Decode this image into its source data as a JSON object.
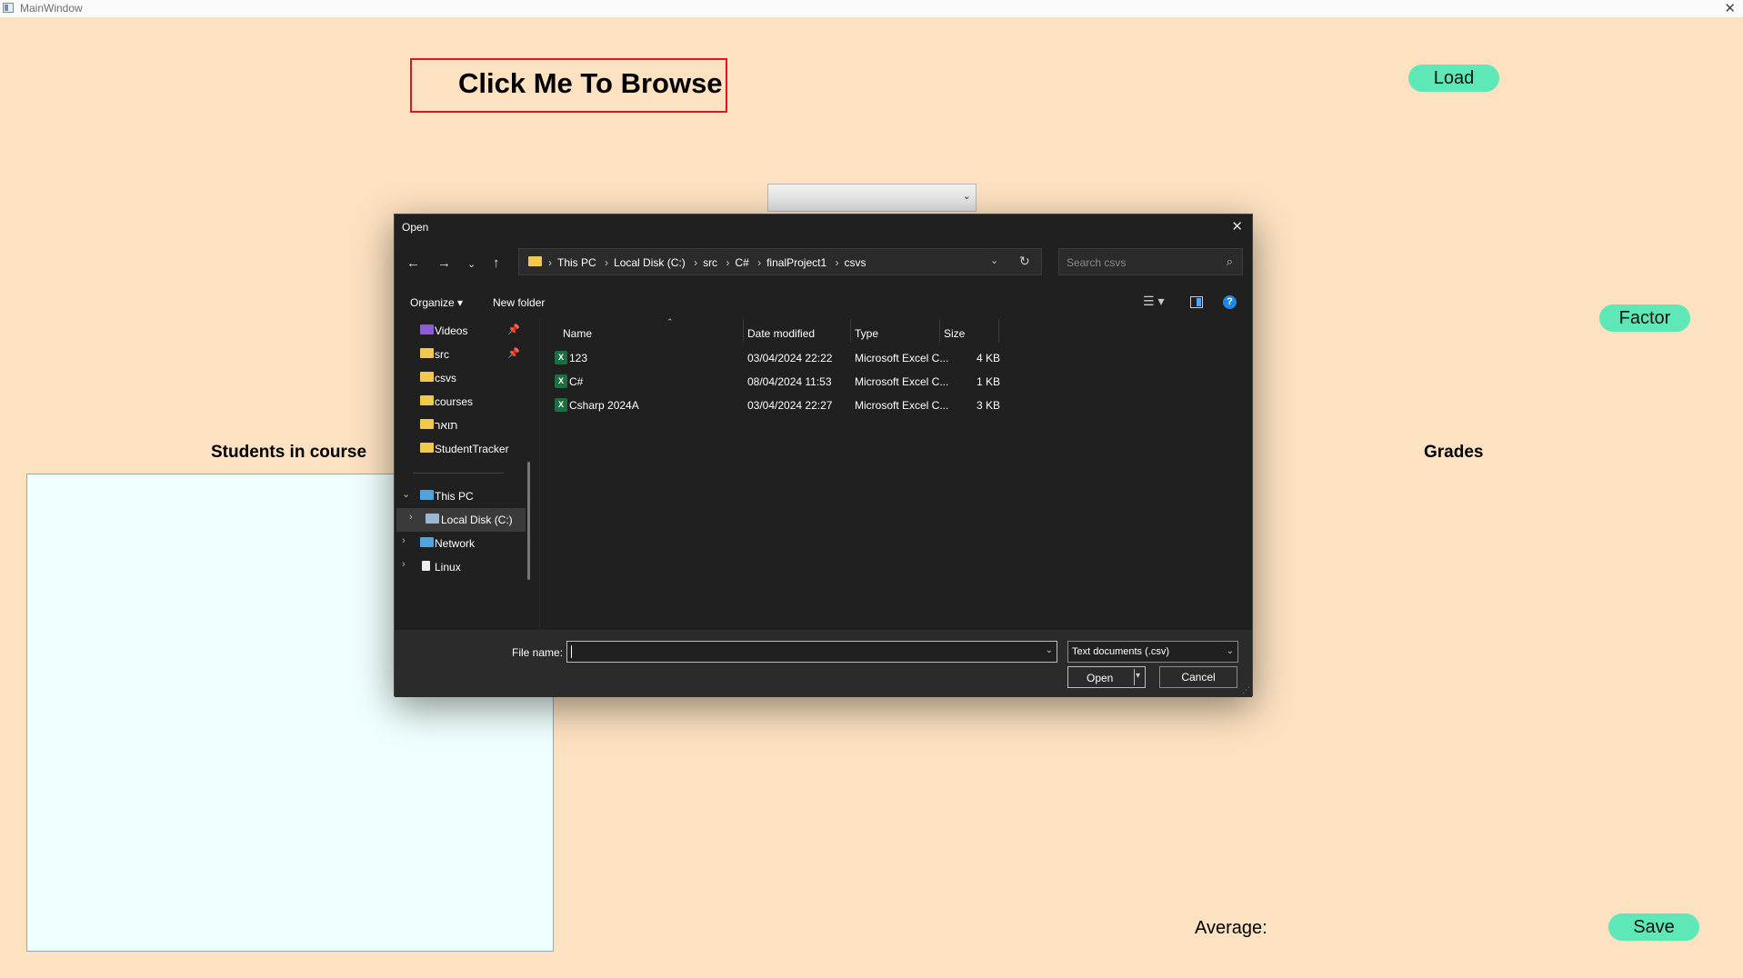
{
  "window": {
    "title": "MainWindow",
    "close_glyph": "✕"
  },
  "main": {
    "browse_button": "Click Me To Browse",
    "load_button": "Load",
    "factor_button": "Factor",
    "save_button": "Save",
    "combo_value": "",
    "students_label": "Students in course",
    "grades_label": "Grades",
    "average_label": "Average:",
    "colors": {
      "background": "#fde2c1",
      "button": "#5ee8b8",
      "browse_border": "#e8121f",
      "list_bg": "#f0ffff"
    }
  },
  "dialog": {
    "title": "Open",
    "close_glyph": "✕",
    "address": [
      "This PC",
      "Local Disk (C:)",
      "src",
      "C#",
      "finalProject1",
      "csvs"
    ],
    "search_placeholder": "Search csvs",
    "toolbar": {
      "organize": "Organize ▾",
      "new_folder": "New folder"
    },
    "nav": [
      {
        "label": "Videos",
        "icon": "videos-icon",
        "pinned": true
      },
      {
        "label": "src",
        "icon": "folder-icon",
        "pinned": true
      },
      {
        "label": "csvs",
        "icon": "folder-icon",
        "pinned": false
      },
      {
        "label": "courses",
        "icon": "folder-icon",
        "pinned": false
      },
      {
        "label": "תואר",
        "icon": "folder-icon",
        "pinned": false
      },
      {
        "label": "StudentTracker",
        "icon": "folder-icon",
        "pinned": false
      },
      {
        "label": "This PC",
        "icon": "computer-icon",
        "expanded": true
      },
      {
        "label": "Local Disk (C:)",
        "icon": "drive-icon",
        "selected": true
      },
      {
        "label": "Network",
        "icon": "network-icon"
      },
      {
        "label": "Linux",
        "icon": "linux-icon"
      }
    ],
    "columns": {
      "name": "Name",
      "date": "Date modified",
      "type": "Type",
      "size": "Size"
    },
    "files": [
      {
        "name": "123",
        "date": "03/04/2024 22:22",
        "type": "Microsoft Excel C...",
        "size": "4 KB"
      },
      {
        "name": "C#",
        "date": "08/04/2024 11:53",
        "type": "Microsoft Excel C...",
        "size": "1 KB"
      },
      {
        "name": "Csharp 2024A",
        "date": "03/04/2024 22:27",
        "type": "Microsoft Excel C...",
        "size": "3 KB"
      }
    ],
    "file_name_label": "File name:",
    "file_name_value": "",
    "filter": "Text documents (.csv)",
    "open_button": "Open",
    "cancel_button": "Cancel"
  }
}
